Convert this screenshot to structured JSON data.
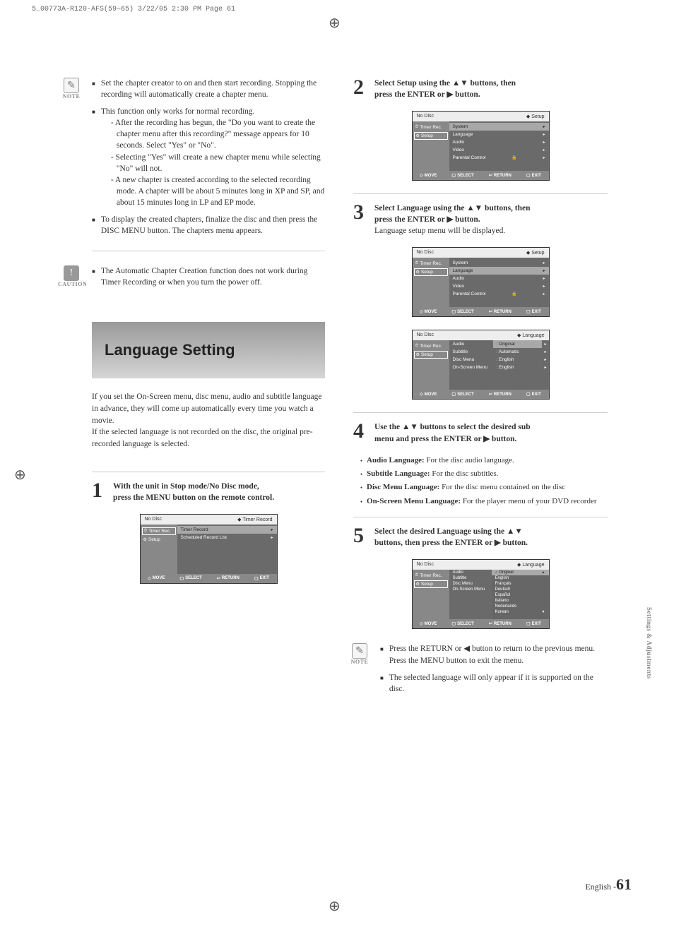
{
  "print_header": "5_00773A-R120-AFS(59~65)  3/22/05  2:30 PM  Page 61",
  "note_label": "NOTE",
  "caution_label": "CAUTION",
  "left": {
    "note_items": {
      "n1": "Set the chapter creator to on and then start recording. Stopping the recording will automatically create a chapter menu.",
      "n2": "This function only works for normal recording.",
      "n2a": "- After the recording has begun, the \"Do you want to create the chapter menu after this recording?\" message appears for 10 seconds. Select \"Yes\" or \"No\".",
      "n2b": "- Selecting \"Yes\" will create a new chapter menu while selecting \"No\" will not.",
      "n2c": "- A new chapter is created according to the selected recording mode. A chapter will be about 5 minutes long in XP and SP, and about 15 minutes long in LP and EP mode.",
      "n3": "To display the created chapters, finalize the disc and then press the DISC MENU button. The chapters menu appears."
    },
    "caution_item": "The Automatic Chapter Creation function does not work during Timer Recording or when you turn the power off.",
    "section_title": "Language Setting",
    "intro": "If you set the On-Screen menu, disc menu, audio and subtitle language in advance, they will come up automatically every time you watch a movie.\nIf the selected language is not recorded on the disc, the original pre-recorded language is selected.",
    "step1_a": "With the unit in Stop mode/No Disc mode,",
    "step1_b": "press the MENU button on the remote control."
  },
  "right": {
    "step2_a": "Select Setup using the ▲▼ buttons, then",
    "step2_b": "press the ENTER or ▶ button.",
    "step3_a": "Select Language using the ▲▼ buttons, then",
    "step3_b": "press the ENTER or ▶ button.",
    "step3_c": "Language setup menu will be displayed.",
    "step4_a": "Use the ▲▼ buttons to select the desired sub",
    "step4_b": "menu and press the ENTER or ▶ button.",
    "sub4": {
      "a_label": "Audio Language:",
      "a_desc": " For the disc audio language.",
      "b_label": "Subtitle Language:",
      "b_desc": " For the disc subtitles.",
      "c_label": "Disc Menu Language:",
      "c_desc": " For the disc menu contained on the disc",
      "d_label": "On-Screen Menu Language:",
      "d_desc": " For the player menu of your DVD recorder"
    },
    "step5_a": "Select the desired Language using the ▲▼",
    "step5_b": "buttons, then press the ENTER or ▶ button.",
    "end_note1": "Press the RETURN or ◀ button to return to the previous menu.",
    "end_note1b": "Press the MENU button to exit the menu.",
    "end_note2": "The selected language will only appear if it is supported on the disc."
  },
  "osd": {
    "nodisc": "No Disc",
    "setup_tag": "Setup",
    "lang_tag": "Language",
    "timer_tag": "Timer Record",
    "side_timer": "Timer Rec.",
    "side_setup": "Setup",
    "rows": {
      "system": "System",
      "language": "Language",
      "audio": "Audio",
      "video": "Video",
      "parental": "Parental Control",
      "timer_record": "Timer Record",
      "sched_list": "Scheduled Record List",
      "subtitle": "Subtitle",
      "disc_menu": "Disc Menu",
      "on_screen": "On-Screen Menu"
    },
    "vals": {
      "original": ": Original",
      "automatic": ": Automatic",
      "english": ": English"
    },
    "opts": {
      "original": "Original",
      "english": "English",
      "francais": "Français",
      "deutsch": "Deutsch",
      "espanol": "Español",
      "italiano": "Italiano",
      "nederlands": "Nederlands",
      "korean": "Korean"
    },
    "footer": {
      "move": "MOVE",
      "select": "SELECT",
      "return": "RETURN",
      "exit": "EXIT"
    }
  },
  "side_tab": "Settings & Adjustments",
  "footer_lang": "English -",
  "footer_page": "61"
}
